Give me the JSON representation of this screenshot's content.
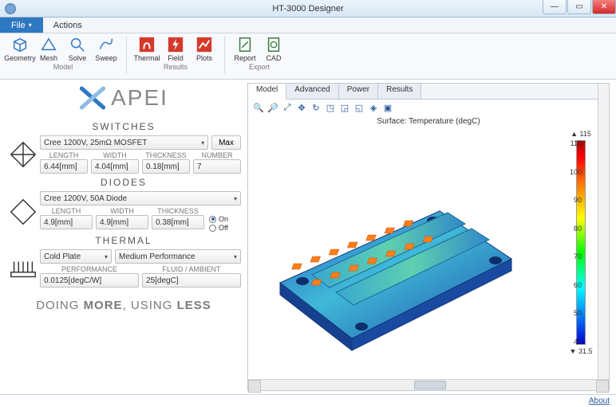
{
  "window": {
    "title": "HT-3000 Designer"
  },
  "menu": {
    "file": "File",
    "actions": "Actions"
  },
  "ribbon": {
    "groups": [
      {
        "label": "Model",
        "buttons": [
          "Geometry",
          "Mesh",
          "Solve",
          "Sweep"
        ]
      },
      {
        "label": "Results",
        "buttons": [
          "Thermal",
          "Field",
          "Plots"
        ]
      },
      {
        "label": "Export",
        "buttons": [
          "Report",
          "CAD"
        ]
      }
    ]
  },
  "brand": {
    "name": "APEI",
    "tagline_pre": "DOING ",
    "tagline_b1": "MORE",
    "tagline_mid": ", USING ",
    "tagline_b2": "LESS"
  },
  "switches": {
    "title": "SWITCHES",
    "device": "Cree 1200V, 25mΩ MOSFET",
    "max_btn": "Max",
    "hdrs": [
      "LENGTH",
      "WIDTH",
      "THICKNESS",
      "NUMBER"
    ],
    "vals": [
      "6.44[mm]",
      "4.04[mm]",
      "0.18[mm]",
      "7"
    ]
  },
  "diodes": {
    "title": "DIODES",
    "device": "Cree 1200V, 50A Diode",
    "hdrs": [
      "LENGTH",
      "WIDTH",
      "THICKNESS"
    ],
    "vals": [
      "4.9[mm]",
      "4.9[mm]",
      "0.38[mm]"
    ],
    "radio_on": "On",
    "radio_off": "Off"
  },
  "thermal": {
    "title": "THERMAL",
    "sink": "Cold Plate",
    "perf": "Medium Performance",
    "hdrs": [
      "PERFORMANCE",
      "FLUID / AMBIENT"
    ],
    "vals": [
      "0.0125[degC/W]",
      "25[degC]"
    ]
  },
  "viewer": {
    "tabs": [
      "Model",
      "Advanced",
      "Power",
      "Results"
    ],
    "surface_label": "Surface: Temperature (degC)",
    "legend_max": "115",
    "legend_min": "31.5",
    "legend_ticks": [
      "110",
      "100",
      "90",
      "80",
      "70",
      "60",
      "50",
      "40"
    ]
  },
  "status": {
    "about": "About"
  }
}
